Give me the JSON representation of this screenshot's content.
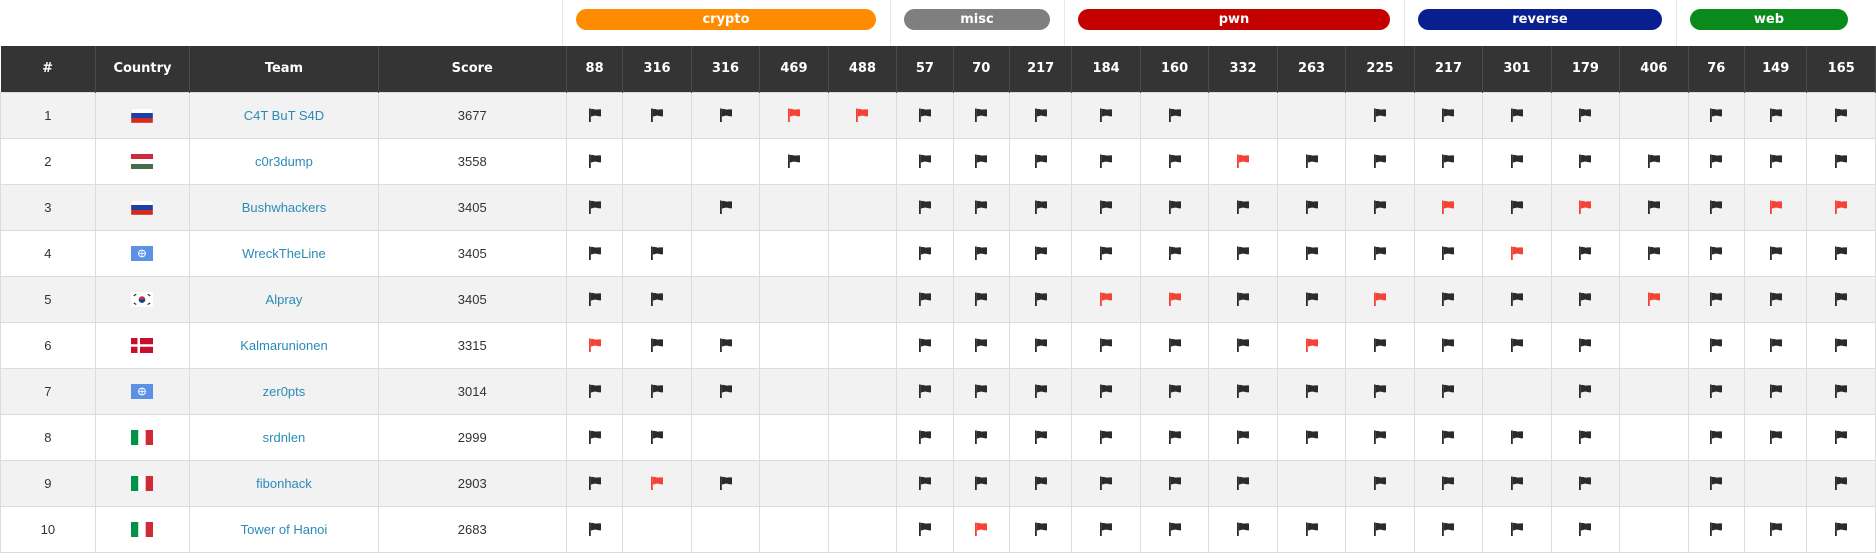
{
  "categories": [
    {
      "name": "crypto",
      "color": "#ff8c00"
    },
    {
      "name": "misc",
      "color": "#7f7f7f"
    },
    {
      "name": "pwn",
      "color": "#c40000"
    },
    {
      "name": "reverse",
      "color": "#0a1f8f"
    },
    {
      "name": "web",
      "color": "#0a8a1a"
    }
  ],
  "header": {
    "rank": "#",
    "country": "Country",
    "team": "Team",
    "score": "Score"
  },
  "challenge_points": [
    "88",
    "316",
    "316",
    "469",
    "488",
    "57",
    "70",
    "217",
    "184",
    "160",
    "332",
    "263",
    "225",
    "217",
    "301",
    "179",
    "406",
    "76",
    "149",
    "165"
  ],
  "challenge_categories": [
    "crypto",
    "crypto",
    "crypto",
    "crypto",
    "crypto",
    "misc",
    "misc",
    "misc",
    "pwn",
    "pwn",
    "pwn",
    "pwn",
    "pwn",
    "reverse",
    "reverse",
    "reverse",
    "reverse",
    "web",
    "web",
    "web"
  ],
  "solve_colors": {
    "solved": "#2b2b2b",
    "first_blood": "#f44336"
  },
  "rows": [
    {
      "rank": "1",
      "country": "russia",
      "team": "C4T BuT S4D",
      "score": "3677",
      "solves": [
        "s",
        "s",
        "s",
        "f",
        "f",
        "s",
        "s",
        "s",
        "s",
        "s",
        "",
        "",
        "s",
        "s",
        "s",
        "s",
        "",
        "s",
        "s",
        "s"
      ]
    },
    {
      "rank": "2",
      "country": "hungary",
      "team": "c0r3dump",
      "score": "3558",
      "solves": [
        "s",
        "",
        "",
        "s",
        "",
        "s",
        "s",
        "s",
        "s",
        "s",
        "f",
        "s",
        "s",
        "s",
        "s",
        "s",
        "s",
        "s",
        "s",
        "s"
      ]
    },
    {
      "rank": "3",
      "country": "russia",
      "team": "Bushwhackers",
      "score": "3405",
      "solves": [
        "s",
        "",
        "s",
        "",
        "",
        "s",
        "s",
        "s",
        "s",
        "s",
        "s",
        "s",
        "s",
        "f",
        "s",
        "f",
        "s",
        "s",
        "f",
        "f"
      ]
    },
    {
      "rank": "4",
      "country": "un",
      "team": "WreckTheLine",
      "score": "3405",
      "solves": [
        "s",
        "s",
        "",
        "",
        "",
        "s",
        "s",
        "s",
        "s",
        "s",
        "s",
        "s",
        "s",
        "s",
        "f",
        "s",
        "s",
        "s",
        "s",
        "s"
      ]
    },
    {
      "rank": "5",
      "country": "south-korea",
      "team": "Alpray",
      "score": "3405",
      "solves": [
        "s",
        "s",
        "",
        "",
        "",
        "s",
        "s",
        "s",
        "f",
        "f",
        "s",
        "s",
        "f",
        "s",
        "s",
        "s",
        "f",
        "s",
        "s",
        "s"
      ]
    },
    {
      "rank": "6",
      "country": "denmark",
      "team": "Kalmarunionen",
      "score": "3315",
      "solves": [
        "f",
        "s",
        "s",
        "",
        "",
        "s",
        "s",
        "s",
        "s",
        "s",
        "s",
        "f",
        "s",
        "s",
        "s",
        "s",
        "",
        "s",
        "s",
        "s"
      ]
    },
    {
      "rank": "7",
      "country": "un",
      "team": "zer0pts",
      "score": "3014",
      "solves": [
        "s",
        "s",
        "s",
        "",
        "",
        "s",
        "s",
        "s",
        "s",
        "s",
        "s",
        "s",
        "s",
        "s",
        "",
        "s",
        "",
        "s",
        "s",
        "s"
      ]
    },
    {
      "rank": "8",
      "country": "italy",
      "team": "srdnlen",
      "score": "2999",
      "solves": [
        "s",
        "s",
        "",
        "",
        "",
        "s",
        "s",
        "s",
        "s",
        "s",
        "s",
        "s",
        "s",
        "s",
        "s",
        "s",
        "",
        "s",
        "s",
        "s"
      ]
    },
    {
      "rank": "9",
      "country": "italy",
      "team": "fibonhack",
      "score": "2903",
      "solves": [
        "s",
        "f",
        "s",
        "",
        "",
        "s",
        "s",
        "s",
        "s",
        "s",
        "s",
        "",
        "s",
        "s",
        "s",
        "s",
        "",
        "s",
        "",
        "s"
      ]
    },
    {
      "rank": "10",
      "country": "italy",
      "team": "Tower of Hanoi",
      "score": "2683",
      "solves": [
        "s",
        "",
        "",
        "",
        "",
        "s",
        "f",
        "s",
        "s",
        "s",
        "s",
        "s",
        "s",
        "s",
        "s",
        "s",
        "",
        "s",
        "s",
        "s"
      ]
    }
  ]
}
